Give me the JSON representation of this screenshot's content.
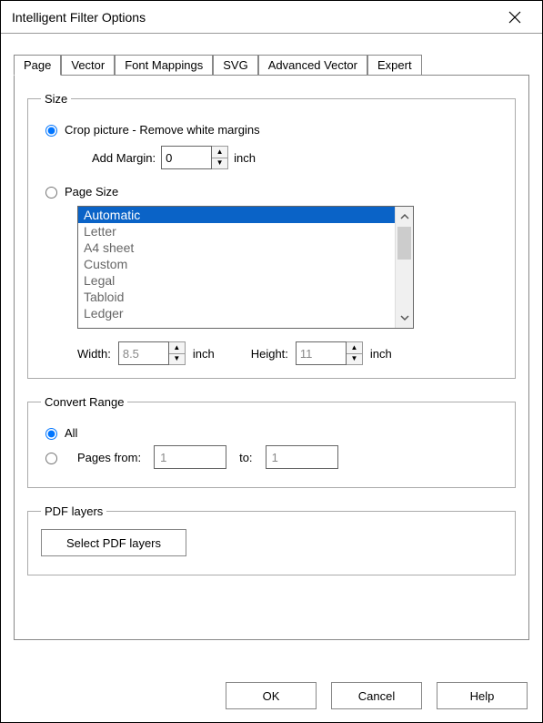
{
  "window": {
    "title": "Intelligent Filter Options"
  },
  "tabs": {
    "page": "Page",
    "vector": "Vector",
    "font_mappings": "Font Mappings",
    "svg": "SVG",
    "advanced_vector": "Advanced Vector",
    "expert": "Expert"
  },
  "size": {
    "legend": "Size",
    "crop_label": "Crop picture - Remove white margins",
    "add_margin_label": "Add Margin:",
    "add_margin_value": "0",
    "add_margin_unit": "inch",
    "page_size_label": "Page Size",
    "options": [
      "Automatic",
      "Letter",
      "A4 sheet",
      "Custom",
      "Legal",
      "Tabloid",
      "Ledger"
    ],
    "width_label": "Width:",
    "width_value": "8.5",
    "width_unit": "inch",
    "height_label": "Height:",
    "height_value": "11",
    "height_unit": "inch"
  },
  "convert_range": {
    "legend": "Convert Range",
    "all_label": "All",
    "pages_from_label": "Pages from:",
    "from_value": "1",
    "to_label": "to:",
    "to_value": "1"
  },
  "pdf_layers": {
    "legend": "PDF layers",
    "button": "Select PDF layers"
  },
  "footer": {
    "ok": "OK",
    "cancel": "Cancel",
    "help": "Help"
  }
}
